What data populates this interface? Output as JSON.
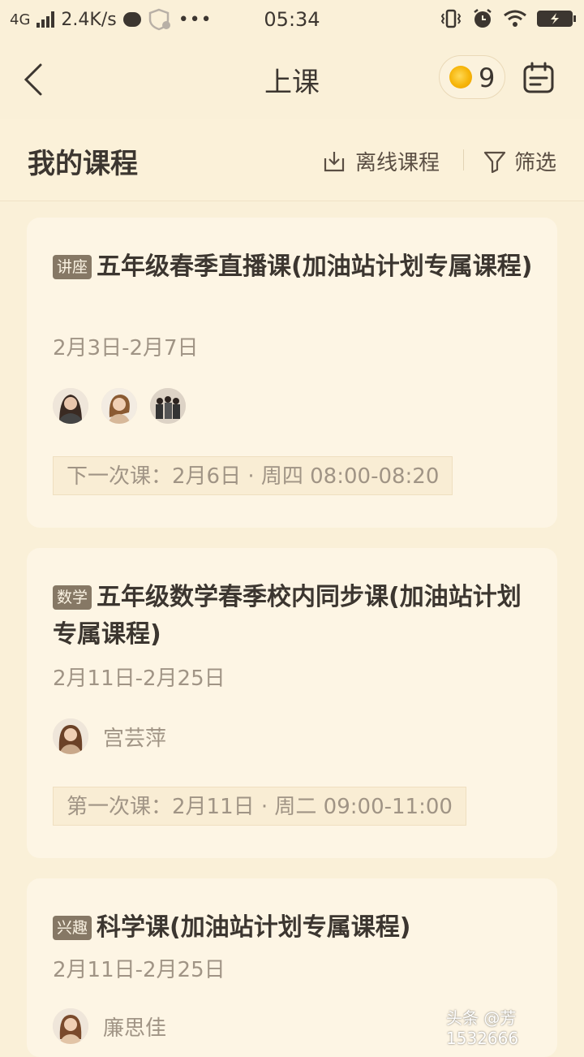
{
  "status_bar": {
    "network": "4G",
    "speed": "2.4K/s",
    "time": "05:34",
    "dots": "•••"
  },
  "nav": {
    "title": "上课",
    "coin_count": "9"
  },
  "section": {
    "title": "我的课程",
    "offline_label": "离线课程",
    "filter_label": "筛选"
  },
  "courses": [
    {
      "tag": "讲座",
      "title": "五年级春季直播课(加油站计划专属课程)",
      "dates": "2月3日-2月7日",
      "teacher": "",
      "next_lesson": "下一次课：2月6日 · 周四 08:00-08:20"
    },
    {
      "tag": "数学",
      "title": "五年级数学春季校内同步课(加油站计划专属课程)",
      "dates": "2月11日-2月25日",
      "teacher": "宫芸萍",
      "next_lesson": "第一次课：2月11日 · 周二 09:00-11:00"
    },
    {
      "tag": "兴趣",
      "title": "科学课(加油站计划专属课程)",
      "dates": "2月11日-2月25日",
      "teacher": "廉思佳"
    }
  ],
  "watermark": "头条 @芳1532666",
  "colors": {
    "background": "#faf0d8",
    "card": "#fdf5e4",
    "tag": "#867865",
    "coin": "#f6b50a",
    "muted_text": "#a09485"
  }
}
